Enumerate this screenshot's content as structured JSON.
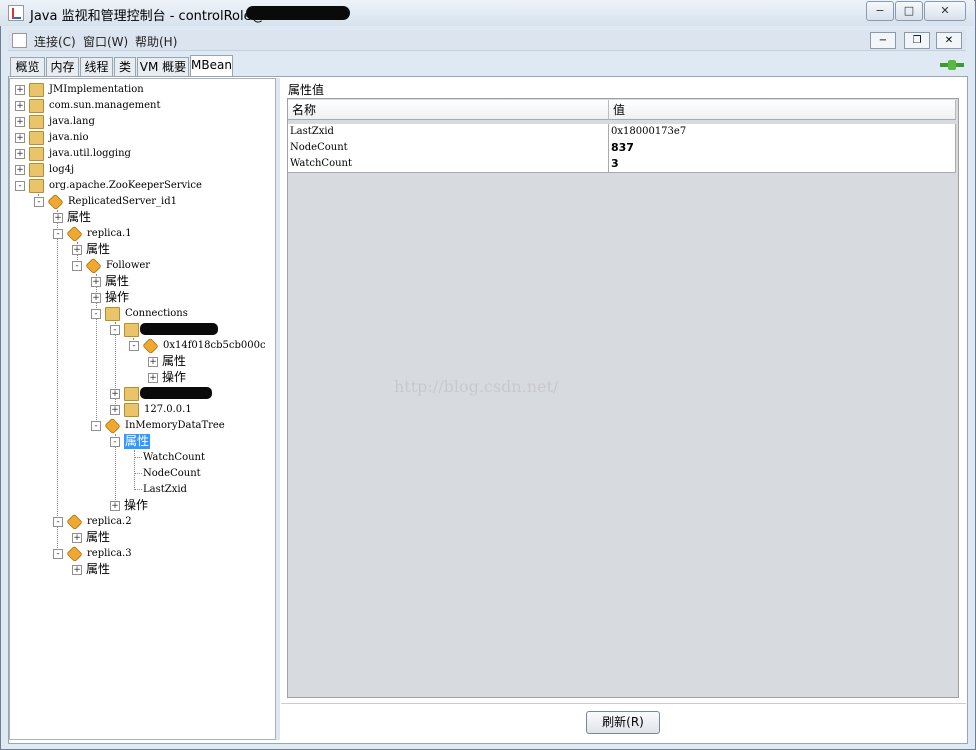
{
  "window": {
    "title": "Java 监视和管理控制台 - controlRole@"
  },
  "menu": {
    "items": [
      "连接(C)",
      "窗口(W)",
      "帮助(H)"
    ]
  },
  "tabs": [
    "概览",
    "内存",
    "线程",
    "类",
    "VM 概要",
    "MBean"
  ],
  "tree": {
    "jmi": "JMImplementation",
    "csm": "com.sun.management",
    "jl": "java.lang",
    "jnio": "java.nio",
    "jul": "java.util.logging",
    "log4j": "log4j",
    "zk": "org.apache.ZooKeeperService",
    "server": "ReplicatedServer_id1",
    "attr": "属性",
    "ops": "操作",
    "replica1": "replica.1",
    "follower": "Follower",
    "connections": "Connections",
    "session": "0x14f018cb5cb000c",
    "localhost": "127.0.0.1",
    "imdt": "InMemoryDataTree",
    "watchcount": "WatchCount",
    "nodecount": "NodeCount",
    "lastzxid": "LastZxid",
    "replica2": "replica.2",
    "replica3": "replica.3"
  },
  "panel": {
    "title": "属性值",
    "col_name": "名称",
    "col_value": "值",
    "rows": [
      {
        "name": "LastZxid",
        "value": "0x18000173e7"
      },
      {
        "name": "NodeCount",
        "value": "837"
      },
      {
        "name": "WatchCount",
        "value": "3"
      }
    ],
    "refresh": "刷新(R)"
  },
  "watermark": "http://blog.csdn.net/"
}
